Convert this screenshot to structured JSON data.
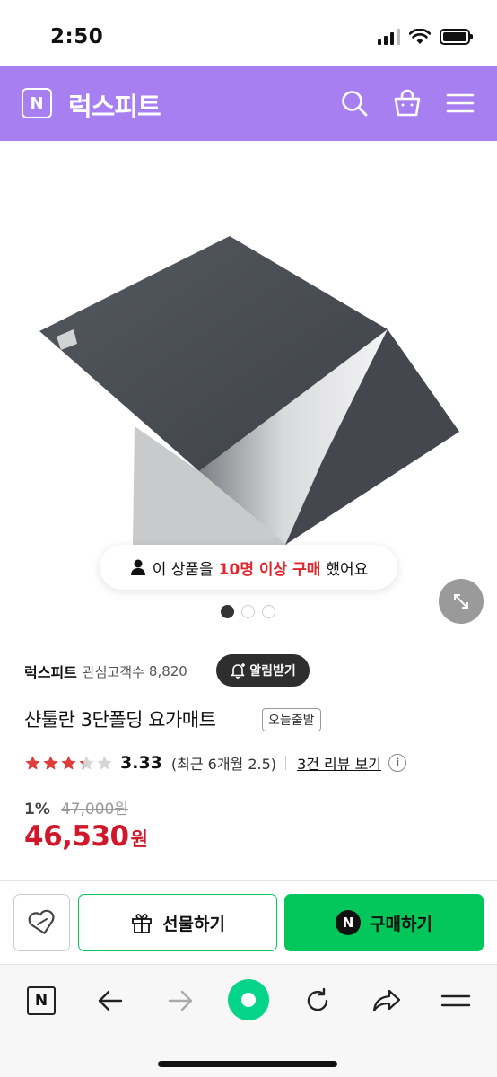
{
  "status_bar": {
    "time": "2:50"
  },
  "header": {
    "logo_letter": "N",
    "brand": "럭스피트"
  },
  "gallery": {
    "purchase_notice": {
      "prefix": "이 상품을",
      "highlight": "10명 이상 구매",
      "suffix": "했어요"
    },
    "page_count": 3,
    "current_page": 1
  },
  "seller": {
    "name": "럭스피트",
    "fav_label": "관심고객수",
    "fav_count": "8,820",
    "alarm_label": "알림받기"
  },
  "product": {
    "title": "샨툴란 3단폴딩 요가매트",
    "badge": "오늘출발",
    "rating": 3.33,
    "rating_text": "3.33",
    "recent_rating": "(최근 6개월 2.5)",
    "review_link": "3건 리뷰 보기",
    "discount_rate": "1%",
    "original_price": "47,000원",
    "final_price": "46,530",
    "currency": "원"
  },
  "buy_bar": {
    "gift_label": "선물하기",
    "buy_label": "구매하기",
    "buy_icon_letter": "N"
  },
  "toolbar": {
    "n_letter": "N"
  },
  "colors": {
    "header": "#a77ff0",
    "naver_green": "#03c75a",
    "price_red": "#d1172a",
    "star": "#e03c3c"
  }
}
